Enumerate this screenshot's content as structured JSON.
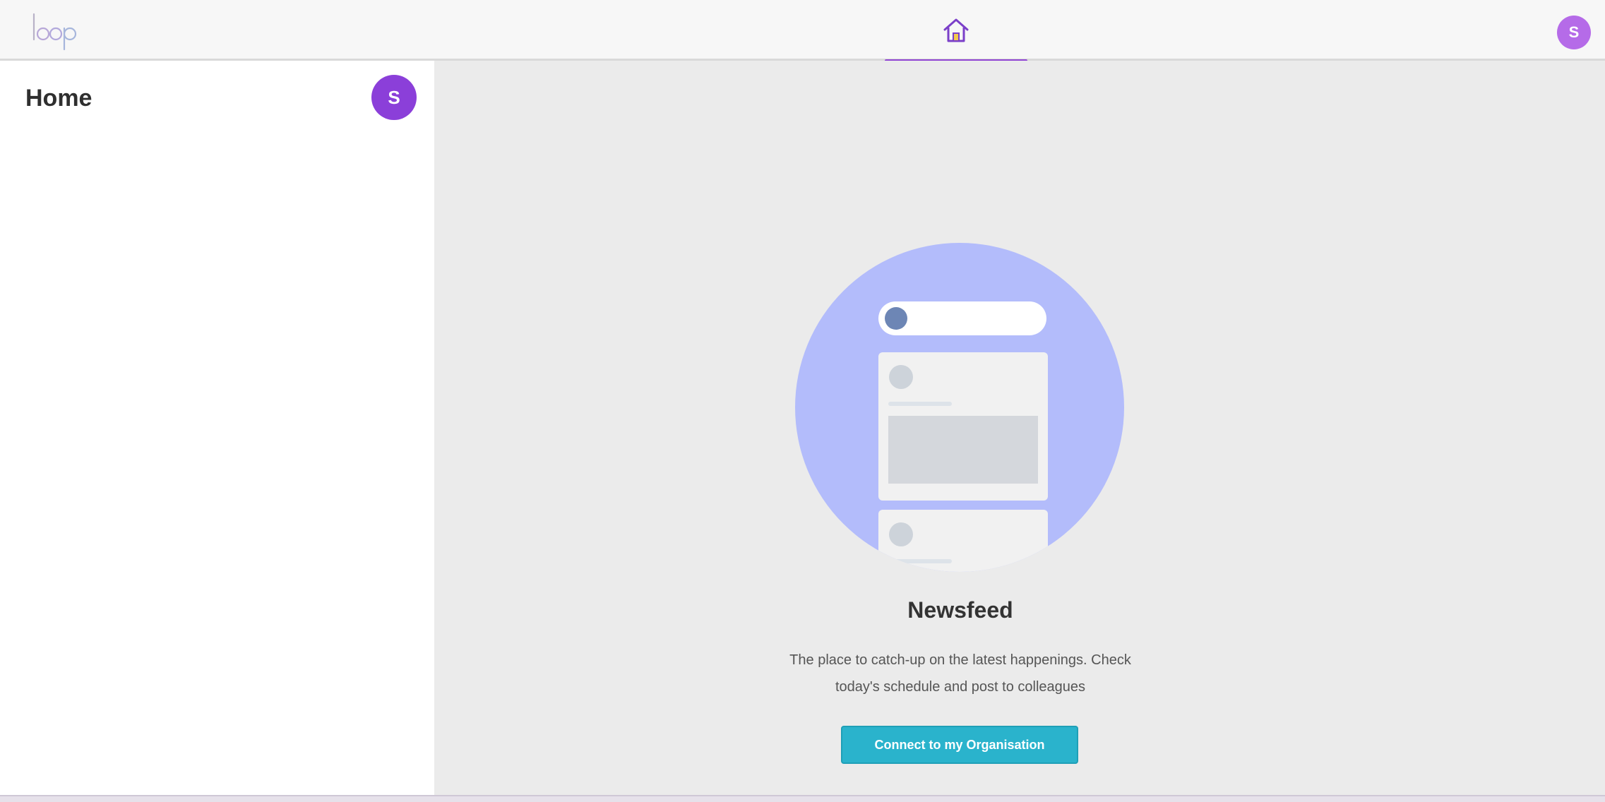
{
  "app": {
    "logo_text": "loop"
  },
  "topbar": {
    "nav_items": [
      {
        "icon": "home-icon",
        "active": true
      }
    ],
    "user_avatar_initial": "S"
  },
  "sidebar": {
    "title": "Home",
    "avatar_initial": "S"
  },
  "main": {
    "empty_state": {
      "illustration": "newsfeed-illustration",
      "title": "Newsfeed",
      "description_line1": "The place to catch-up on the latest happenings. Check",
      "description_line2": "today's schedule and post to colleagues",
      "button_label": "Connect to my Organisation"
    }
  },
  "colors": {
    "accent_purple": "#9146d4",
    "avatar_purple": "#8b3fd9",
    "button_teal": "#2ab3cc",
    "illustration_circle": "#b3bcfb",
    "main_background": "#ebebeb"
  }
}
